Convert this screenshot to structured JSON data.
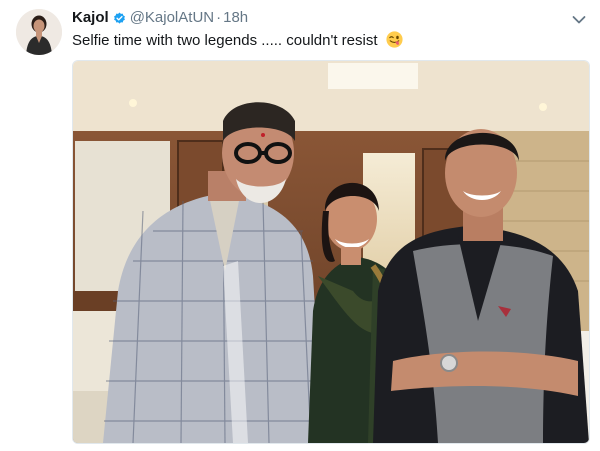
{
  "tweet": {
    "display_name": "Kajol",
    "handle": "@KajolAtUN",
    "separator": "·",
    "timestamp": "18h",
    "text": "Selfie time with two legends ..... couldn't resist",
    "emoji": "winking-face-with-tongue",
    "verified": true
  },
  "icons": {
    "verified": "verified-badge-icon",
    "caret": "chevron-down-icon"
  },
  "colors": {
    "verified_blue": "#1da1f2",
    "secondary_text": "#657786",
    "primary_text": "#14171a"
  }
}
